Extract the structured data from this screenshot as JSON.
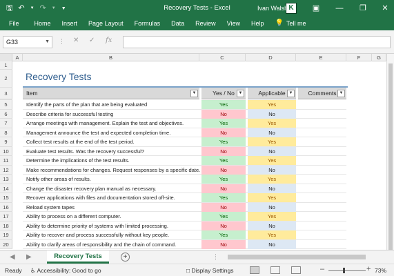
{
  "titlebar": {
    "title": "Recovery Tests  -  Excel",
    "user_name": "Ivan Walsh",
    "user_initial": "K",
    "icons": [
      "save-icon",
      "undo-icon",
      "redo-icon",
      "customize-qat-icon",
      "ribbon-display-icon",
      "minimize-icon",
      "restore-icon",
      "close-icon"
    ],
    "brand_color": "#217346"
  },
  "ribbon": {
    "tabs": [
      "File",
      "Home",
      "Insert",
      "Page Layout",
      "Formulas",
      "Data",
      "Review",
      "View",
      "Help"
    ],
    "tell_me": "Tell me"
  },
  "formula_bar": {
    "name_box": "G33",
    "formula": "",
    "fx_label": "fx"
  },
  "columns": [
    "A",
    "B",
    "C",
    "D",
    "E",
    "F",
    "G"
  ],
  "sheet": {
    "title": "Recovery Tests",
    "headers": {
      "item": "Item",
      "yes_no": "Yes / No",
      "applicable": "Applicable",
      "comments": "Comments"
    },
    "rows": [
      {
        "num": "5",
        "item": "Identify the parts of the plan that are being evaluated",
        "yn": "Yes",
        "ap": "Yes"
      },
      {
        "num": "6",
        "item": "Describe criteria for successful testing",
        "yn": "No",
        "ap": "No"
      },
      {
        "num": "7",
        "item": "Arrange meetings with management. Explain the test and objectives.",
        "yn": "Yes",
        "ap": "Yes"
      },
      {
        "num": "8",
        "item": "Management announce the test and expected completion time.",
        "yn": "No",
        "ap": "No"
      },
      {
        "num": "9",
        "item": "Collect test results at the end of the test period.",
        "yn": "Yes",
        "ap": "Yes"
      },
      {
        "num": "10",
        "item": "Evaluate test results. Was the recovery successful?",
        "yn": "No",
        "ap": "No"
      },
      {
        "num": "11",
        "item": "Determine the implications of the test results.",
        "yn": "Yes",
        "ap": "Yes"
      },
      {
        "num": "12",
        "item": "Make recommendations for changes. Request responses by a specific date.",
        "yn": "No",
        "ap": "No"
      },
      {
        "num": "13",
        "item": "Notify other areas of results.",
        "yn": "Yes",
        "ap": "Yes"
      },
      {
        "num": "14",
        "item": "Change the disaster recovery plan manual as necessary.",
        "yn": "No",
        "ap": "No"
      },
      {
        "num": "15",
        "item": "Recover applications with files and documentation stored off-site.",
        "yn": "Yes",
        "ap": "Yes"
      },
      {
        "num": "16",
        "item": "Reload system tapes",
        "yn": "No",
        "ap": "No"
      },
      {
        "num": "17",
        "item": "Ability to process on a different computer.",
        "yn": "Yes",
        "ap": "Yes"
      },
      {
        "num": "18",
        "item": "Ability to determine priority of systems with limited processing.",
        "yn": "No",
        "ap": "No"
      },
      {
        "num": "19",
        "item": "Ability to recover and process successfully without key people.",
        "yn": "Yes",
        "ap": "Yes"
      },
      {
        "num": "20",
        "item": "Ability to clarify areas of responsibility and the chain of command.",
        "yn": "No",
        "ap": "No"
      }
    ]
  },
  "sheet_tabs": {
    "active": "Recovery Tests"
  },
  "status": {
    "ready": "Ready",
    "accessibility": "Accessibility: Good to go",
    "display_settings": "Display Settings",
    "zoom": "73%"
  }
}
